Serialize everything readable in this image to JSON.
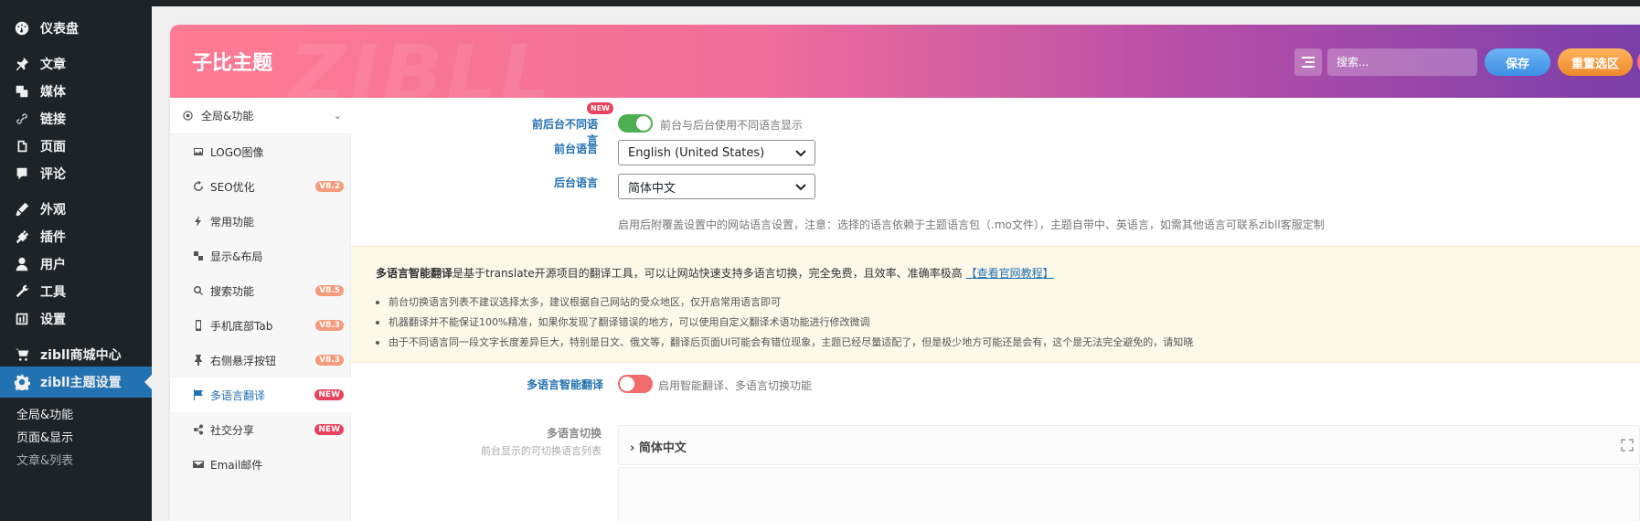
{
  "admin_menu": {
    "items": [
      {
        "label": "仪表盘",
        "icon": "dashboard-icon"
      },
      {
        "label": "文章",
        "icon": "pin-icon"
      },
      {
        "label": "媒体",
        "icon": "media-icon"
      },
      {
        "label": "链接",
        "icon": "link-icon"
      },
      {
        "label": "页面",
        "icon": "page-icon"
      },
      {
        "label": "评论",
        "icon": "comment-icon"
      },
      {
        "label": "外观",
        "icon": "appearance-icon"
      },
      {
        "label": "插件",
        "icon": "plugin-icon"
      },
      {
        "label": "用户",
        "icon": "user-icon"
      },
      {
        "label": "工具",
        "icon": "tools-icon"
      },
      {
        "label": "设置",
        "icon": "settings-icon"
      },
      {
        "label": "zibll商城中心",
        "icon": "cart-icon"
      },
      {
        "label": "zibll主题设置",
        "icon": "gear-icon"
      }
    ],
    "submenu": [
      "全局&功能",
      "页面&显示",
      "文章&列表"
    ]
  },
  "header": {
    "title": "子比主题",
    "watermark": "ZIBLL",
    "search_placeholder": "搜索...",
    "save_label": "保存",
    "reset_label": "重置选区"
  },
  "nav": {
    "parent": "全局&功能",
    "items": [
      {
        "label": "LOGO图像",
        "badge": ""
      },
      {
        "label": "SEO优化",
        "badge": "V8.2"
      },
      {
        "label": "常用功能",
        "badge": ""
      },
      {
        "label": "显示&布局",
        "badge": ""
      },
      {
        "label": "搜索功能",
        "badge": "V8.5"
      },
      {
        "label": "手机底部Tab",
        "badge": "V8.3"
      },
      {
        "label": "右侧悬浮按钮",
        "badge": "V8.3"
      },
      {
        "label": "多语言翻译",
        "badge": "NEW"
      },
      {
        "label": "社交分享",
        "badge": "NEW"
      },
      {
        "label": "Email邮件",
        "badge": ""
      }
    ]
  },
  "fields": {
    "diff_lang_label": "前后台不同语言",
    "diff_lang_new": "NEW",
    "diff_lang_help": "前台与后台使用不同语言显示",
    "front_lang_label": "前台语言",
    "front_lang_value": "English (United States)",
    "back_lang_label": "后台语言",
    "back_lang_value": "简体中文",
    "lang_desc": "启用后附覆盖设置中的网站语言设置，注意：选择的语言依赖于主题语言包（.mo文件），主题自带中、英语言，如需其他语言可联系zibll客服定制",
    "notice_bold": "多语言智能翻译",
    "notice_text": "是基于translate开源项目的翻译工具，可以让网站快速支持多语言切换，完全免费，且效率、准确率极高",
    "notice_link": "【查看官网教程】",
    "notice_items": [
      "前台切换语言列表不建议选择太多，建议根据自己网站的受众地区，仅开启常用语言即可",
      "机器翻译并不能保证100%精准，如果你发现了翻译错误的地方，可以使用自定义翻译术语功能进行修改微调",
      "由于不同语言同一段文字长度差异巨大，特别是日文、俄文等，翻译后页面UI可能会有错位现象，主题已经尽量适配了，但是极少地方可能还是会有，这个是无法完全避免的，请知晓"
    ],
    "smart_label": "多语言智能翻译",
    "smart_help": "启用智能翻译、多语言切换功能",
    "switch_label": "多语言切换",
    "switch_sub": "前台显示的可切换语言列表",
    "switch_item": "简体中文"
  }
}
